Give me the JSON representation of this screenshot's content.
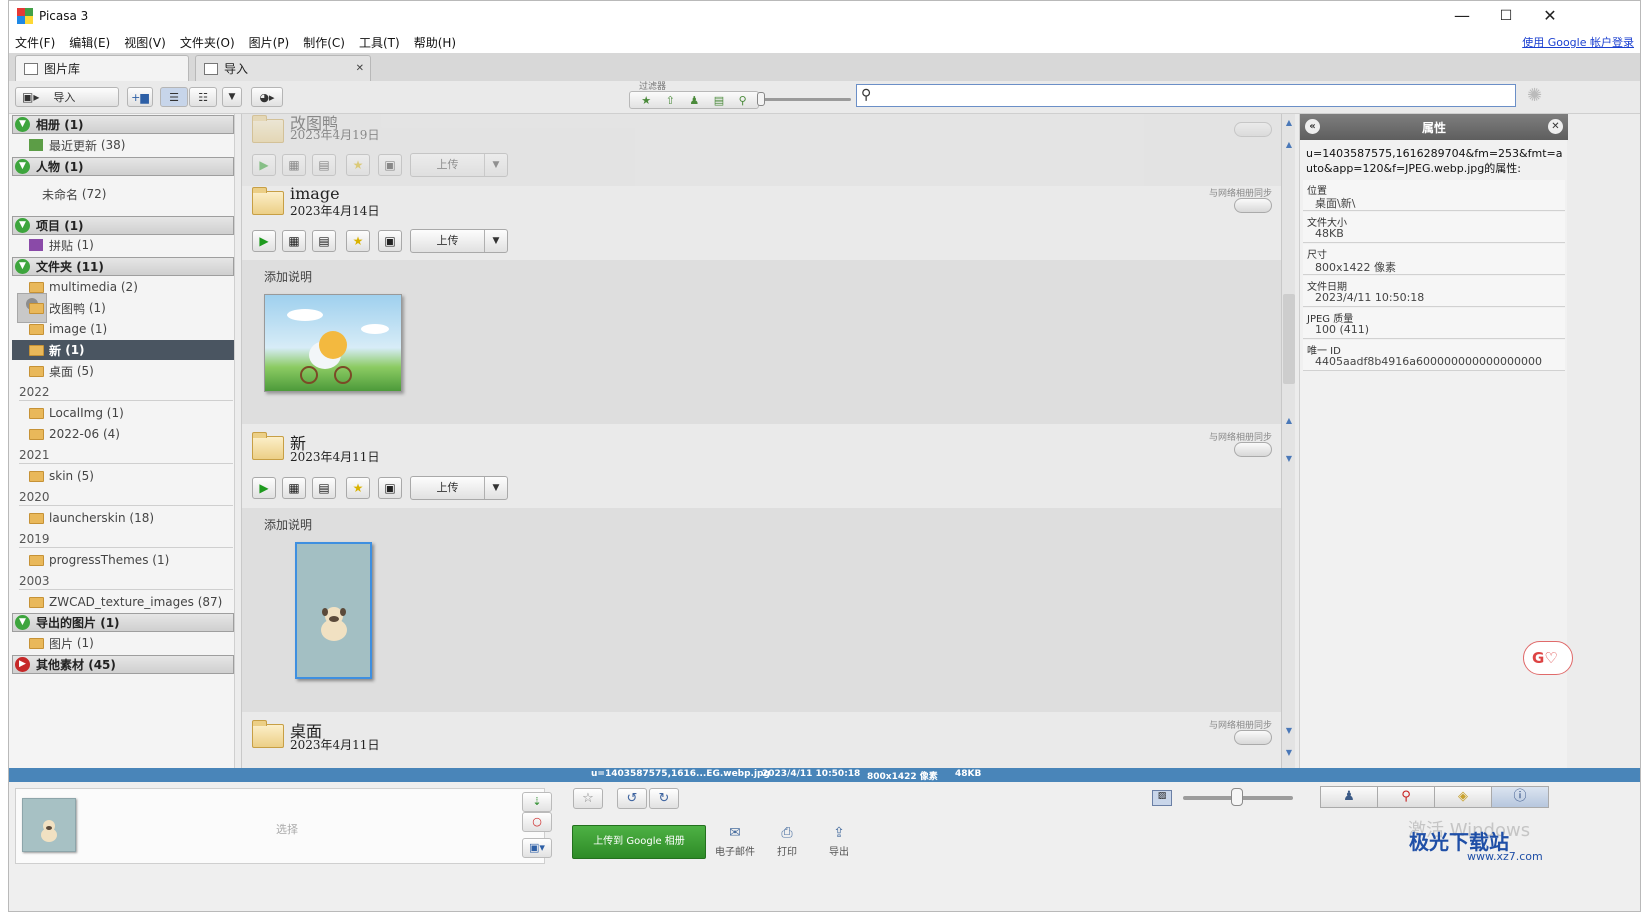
{
  "window": {
    "title": "Picasa 3",
    "minimize": "—",
    "maximize": "☐",
    "close": "✕"
  },
  "menu": [
    "文件(F)",
    "编辑(E)",
    "视图(V)",
    "文件夹(O)",
    "图片(P)",
    "制作(C)",
    "工具(T)",
    "帮助(H)"
  ],
  "google_login": "使用 Google 帐户登录",
  "tabs": [
    {
      "label": "图片库",
      "icon": "library-icon"
    },
    {
      "label": "导入",
      "icon": "import-icon",
      "close": "✕"
    }
  ],
  "toolbar": {
    "import_label": "导入",
    "filter_label": "过滤器",
    "search_placeholder": ""
  },
  "tree": {
    "albums": {
      "label": "相册",
      "count": "(1)",
      "items": [
        {
          "label": "最近更新",
          "count": "(38)"
        }
      ]
    },
    "people": {
      "label": "人物",
      "count": "(1)",
      "items": [
        {
          "label": "未命名",
          "count": "(72)"
        }
      ]
    },
    "projects": {
      "label": "项目",
      "count": "(1)",
      "items": [
        {
          "label": "拼贴",
          "count": "(1)"
        }
      ]
    },
    "folders": {
      "label": "文件夹",
      "count": "(11)",
      "items": [
        {
          "label": "multimedia",
          "count": "(2)"
        },
        {
          "label": "改图鸭",
          "count": "(1)"
        },
        {
          "label": "image",
          "count": "(1)"
        },
        {
          "label": "新",
          "count": "(1)"
        },
        {
          "label": "桌面",
          "count": "(5)"
        }
      ],
      "years": [
        {
          "year": "2022",
          "items": [
            {
              "label": "LocalImg",
              "count": "(1)"
            },
            {
              "label": "2022-06",
              "count": "(4)"
            }
          ]
        },
        {
          "year": "2021",
          "items": [
            {
              "label": "skin",
              "count": "(5)"
            }
          ]
        },
        {
          "year": "2020",
          "items": [
            {
              "label": "launcherskin",
              "count": "(18)"
            }
          ]
        },
        {
          "year": "2019",
          "items": [
            {
              "label": "progressThemes",
              "count": "(1)"
            }
          ]
        },
        {
          "year": "2003",
          "items": [
            {
              "label": "ZWCAD_texture_images",
              "count": "(87)"
            }
          ]
        }
      ]
    },
    "exported": {
      "label": "导出的图片",
      "count": "(1)",
      "items": [
        {
          "label": "图片",
          "count": "(1)"
        }
      ]
    },
    "other": {
      "label": "其他素材",
      "count": "(45)"
    }
  },
  "sections": [
    {
      "name": "改图鸭",
      "date": "2023年4月19日",
      "upload": "上传"
    },
    {
      "name": "image",
      "date": "2023年4月14日",
      "sync": "与网络相册同步",
      "upload": "上传",
      "caption": "添加说明"
    },
    {
      "name": "新",
      "date": "2023年4月11日",
      "sync": "与网络相册同步",
      "upload": "上传",
      "caption": "添加说明"
    },
    {
      "name": "桌面",
      "date": "2023年4月11日",
      "sync": "与网络相册同步"
    }
  ],
  "properties": {
    "title": "属性",
    "filename": "u=1403587575,1616289704&fm=253&fmt=auto&app=120&f=JPEG.webp.jpg的属性:",
    "rows": [
      {
        "key": "位置",
        "value": "桌面\\新\\"
      },
      {
        "key": "文件大小",
        "value": "48KB"
      },
      {
        "key": "尺寸",
        "value": "800x1422 像素"
      },
      {
        "key": "文件日期",
        "value": "2023/4/11 10:50:18"
      },
      {
        "key": "JPEG 质量",
        "value": "100 (411)"
      },
      {
        "key": "唯一 ID",
        "value": "4405aadf8b4916a600000000000000000"
      }
    ]
  },
  "status": {
    "file": "u=1403587575,1616...EG.webp.jpg",
    "date": "2023/4/11 10:50:18",
    "dims": "800x1422 像素",
    "size": "48KB"
  },
  "bottom": {
    "tray_label": "选择",
    "google_upload": "上传到 Google 相册",
    "actions": [
      "电子邮件",
      "打印",
      "导出"
    ]
  },
  "watermark": "激活 Windows",
  "logo": {
    "name": "极光下载站",
    "url": "www.xz7.com"
  },
  "colors": {
    "accent": "#4985b9",
    "selection": "#4a5561",
    "green": "#3da53d",
    "red": "#c62828"
  }
}
